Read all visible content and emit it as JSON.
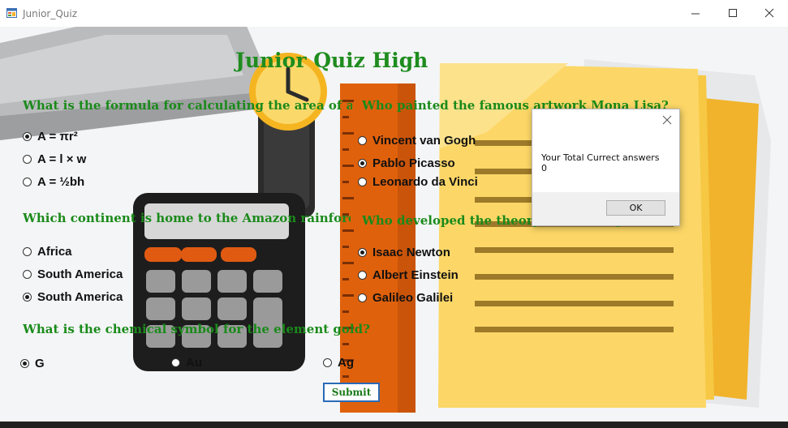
{
  "window": {
    "title": "Junior_Quiz",
    "icon": "winforms-app-icon",
    "controls": [
      "minimize-icon",
      "maximize-icon",
      "close-icon"
    ]
  },
  "heading": "Junior Quiz High",
  "questions": [
    {
      "text": "What is the formula for calculating the area of a",
      "options": [
        {
          "label": "A = πr²",
          "selected": true
        },
        {
          "label": "A = l × w",
          "selected": false
        },
        {
          "label": "A = ½bh",
          "selected": false
        }
      ]
    },
    {
      "text": "Which continent is home to the Amazon rainforest?",
      "options": [
        {
          "label": "Africa",
          "selected": false
        },
        {
          "label": "South America",
          "selected": false
        },
        {
          "label": "South America",
          "selected": true
        }
      ]
    },
    {
      "text": "What is the chemical symbol for the element gold?",
      "options": [
        {
          "label": "G",
          "selected": true
        },
        {
          "label": "Au",
          "selected": false
        },
        {
          "label": "Ag",
          "selected": false
        }
      ]
    },
    {
      "text": "Who painted the famous artwork Mona Lisa?",
      "options": [
        {
          "label": "Vincent van Gogh",
          "selected": false
        },
        {
          "label": "Pablo Picasso",
          "selected": true
        },
        {
          "label": "Leonardo da Vinci",
          "selected": false
        }
      ]
    },
    {
      "text": "Who developed the theory of relativity?",
      "options": [
        {
          "label": "Isaac Newton",
          "selected": true
        },
        {
          "label": "Albert Einstein",
          "selected": false
        },
        {
          "label": "Galileo Galilei",
          "selected": false
        }
      ]
    }
  ],
  "submit_label": "Submit",
  "dialog": {
    "message": "Your Total Currect answers",
    "score": "0",
    "ok_label": "OK"
  },
  "colors": {
    "heading": "#1e8c1e",
    "question": "#1a8a1a",
    "ruler": "#e8680e",
    "paper": "#fbd15a"
  }
}
